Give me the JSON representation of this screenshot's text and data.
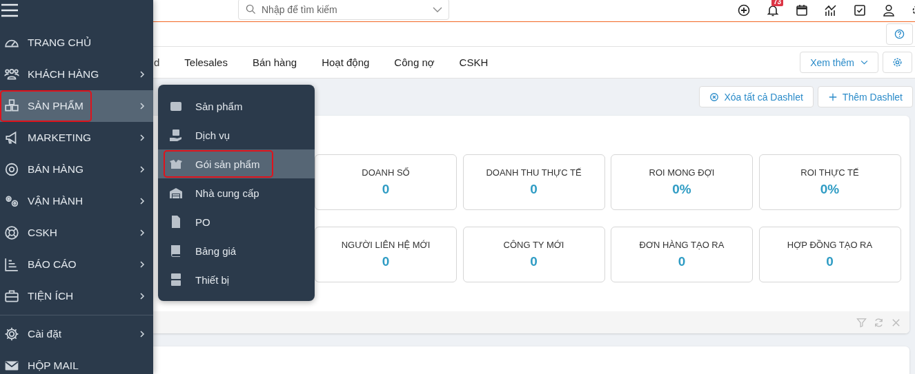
{
  "sidebar": {
    "main_items": [
      {
        "label": "TRANG CHỦ",
        "has_submenu": false,
        "selected": false
      },
      {
        "label": "KHÁCH HÀNG",
        "has_submenu": true,
        "selected": false
      },
      {
        "label": "SẢN PHẨM",
        "has_submenu": true,
        "selected": true
      },
      {
        "label": "MARKETING",
        "has_submenu": true,
        "selected": false
      },
      {
        "label": "BÁN HÀNG",
        "has_submenu": true,
        "selected": false
      },
      {
        "label": "VẬN HÀNH",
        "has_submenu": true,
        "selected": false
      },
      {
        "label": "CSKH",
        "has_submenu": true,
        "selected": false
      },
      {
        "label": "BÁO CÁO",
        "has_submenu": true,
        "selected": false
      },
      {
        "label": "TIỆN ÍCH",
        "has_submenu": true,
        "selected": false
      }
    ],
    "bottom_items": [
      {
        "label": "Cài đặt",
        "has_submenu": true,
        "selected": false
      },
      {
        "label": "HỘP MAIL",
        "has_submenu": false,
        "selected": false
      }
    ]
  },
  "submenu": {
    "items": [
      {
        "label": "Sản phẩm",
        "selected": false
      },
      {
        "label": "Dịch vụ",
        "selected": false
      },
      {
        "label": "Gói sản phẩm",
        "selected": true
      },
      {
        "label": "Nhà cung cấp",
        "selected": false
      },
      {
        "label": "PO",
        "selected": false
      },
      {
        "label": "Bảng giá",
        "selected": false
      },
      {
        "label": "Thiết bị",
        "selected": false
      }
    ]
  },
  "search": {
    "placeholder": "Nhập để tìm kiếm"
  },
  "notifications": {
    "badge": "73"
  },
  "tabs": [
    {
      "label": "d"
    },
    {
      "label": "Telesales"
    },
    {
      "label": "Bán hàng"
    },
    {
      "label": "Hoạt động"
    },
    {
      "label": "Công nợ"
    },
    {
      "label": "CSKH"
    }
  ],
  "more_button": "Xem thêm",
  "dashlet_actions": [
    {
      "kind": "remove",
      "label": "Xóa tất cả Dashlet"
    },
    {
      "kind": "add",
      "label": "Thêm Dashlet"
    }
  ],
  "stats": [
    {
      "label": "DOANH SỐ",
      "value": "0"
    },
    {
      "label": "DOANH THU THỰC TẾ",
      "value": "0"
    },
    {
      "label": "ROI MONG ĐỢI",
      "value": "0%"
    },
    {
      "label": "ROI THỰC TẾ",
      "value": "0%"
    },
    {
      "label": "NGƯỜI LIÊN HỆ MỚI",
      "value": "0"
    },
    {
      "label": "CÔNG TY MỚI",
      "value": "0"
    },
    {
      "label": "ĐƠN HÀNG TẠO RA",
      "value": "0"
    },
    {
      "label": "HỢP ĐỒNG TẠO RA",
      "value": "0"
    }
  ]
}
